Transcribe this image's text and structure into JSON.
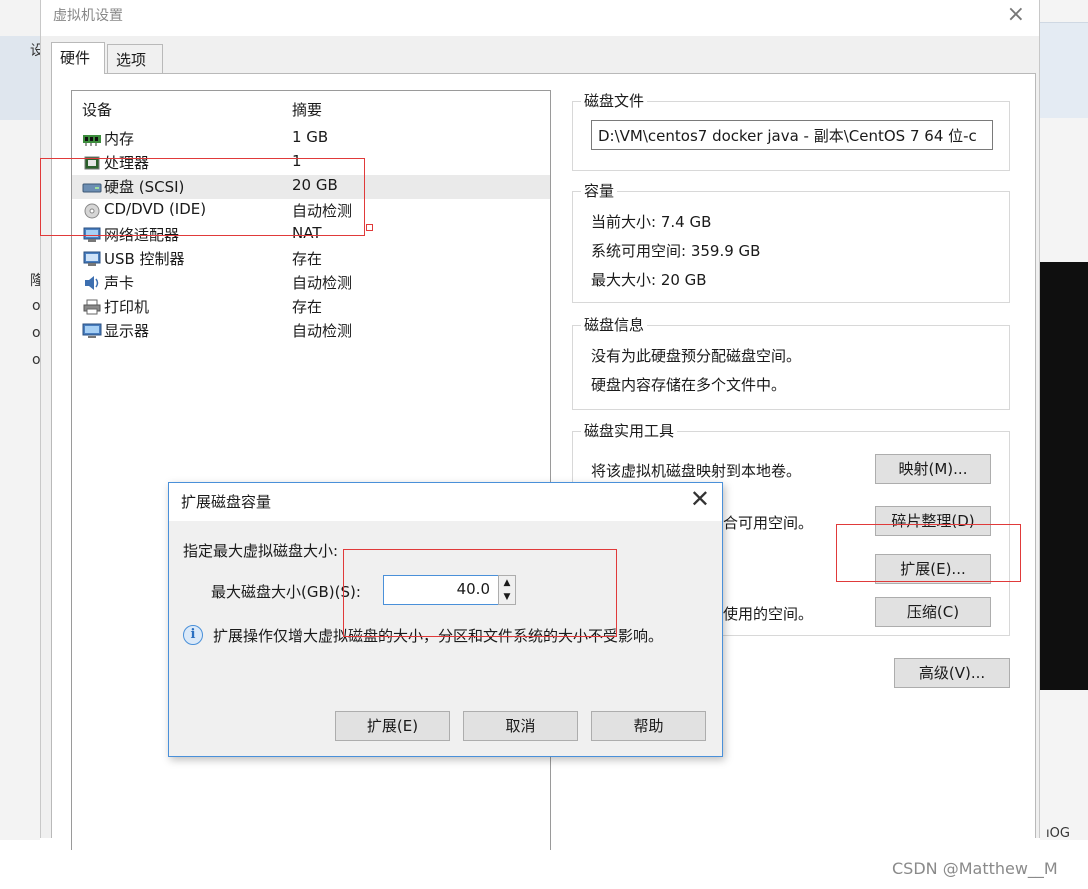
{
  "window": {
    "title": "虚拟机设置",
    "close_glyph": "×"
  },
  "tabs": [
    {
      "label": "硬件"
    },
    {
      "label": "选项"
    }
  ],
  "device_list": {
    "col_device": "设备",
    "col_summary": "摘要",
    "rows": [
      {
        "name": "内存",
        "summary": "1 GB"
      },
      {
        "name": "处理器",
        "summary": "1"
      },
      {
        "name": "硬盘 (SCSI)",
        "summary": "20 GB"
      },
      {
        "name": "CD/DVD (IDE)",
        "summary": "自动检测"
      },
      {
        "name": "网络适配器",
        "summary": "NAT"
      },
      {
        "name": "USB 控制器",
        "summary": "存在"
      },
      {
        "name": "声卡",
        "summary": "自动检测"
      },
      {
        "name": "打印机",
        "summary": "存在"
      },
      {
        "name": "显示器",
        "summary": "自动检测"
      }
    ]
  },
  "disk_file": {
    "title": "磁盘文件",
    "path": "D:\\VM\\centos7 docker java - 副本\\CentOS 7 64 位-c"
  },
  "capacity": {
    "title": "容量",
    "current": "当前大小: 7.4 GB",
    "available": "系统可用空间: 359.9 GB",
    "max": "最大大小: 20 GB"
  },
  "disk_info": {
    "title": "磁盘信息",
    "line1": "没有为此硬盘预分配磁盘空间。",
    "line2": "硬盘内容存储在多个文件中。"
  },
  "disk_tools": {
    "title": "磁盘实用工具",
    "map_text": "将该虚拟机磁盘映射到本地卷。",
    "map_btn": "映射(M)...",
    "defrag_text_tail": "合可用空间。",
    "defrag_btn": "碎片整理(D)",
    "expand_btn": "扩展(E)...",
    "compact_text_tail": "使用的空间。",
    "compact_btn": "压缩(C)"
  },
  "advanced_btn": "高级(V)...",
  "dialog": {
    "title": "扩展磁盘容量",
    "close_glyph": "✕",
    "label_specify": "指定最大虚拟磁盘大小:",
    "label_max": "最大磁盘大小(GB)(S):",
    "value": "40.0",
    "info": "扩展操作仅增大虚拟磁盘的大小，分区和文件系统的大小不受影响。",
    "btn_expand": "扩展(E)",
    "btn_cancel": "取消",
    "btn_help": "帮助"
  },
  "background": {
    "left_glyphs": [
      "设",
      "隆",
      "o",
      "o",
      "o"
    ],
    "right_glyph": "ıOG"
  },
  "watermark": "CSDN @Matthew__M"
}
